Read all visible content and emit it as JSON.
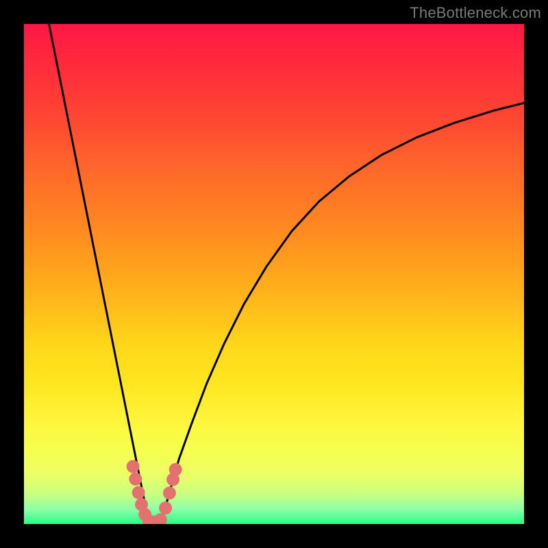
{
  "watermark": "TheBottleneck.com",
  "colors": {
    "frame": "#000000",
    "curve": "#000000",
    "marker": "#e2716f",
    "gradient_top": "#ff1744",
    "gradient_bottom": "#29ff86"
  },
  "chart_data": {
    "type": "line",
    "title": "",
    "xlabel": "",
    "ylabel": "",
    "xlim": [
      0,
      100
    ],
    "ylim": [
      0,
      100
    ],
    "series": [
      {
        "name": "left-branch",
        "x": [
          5.0,
          6.0,
          7.0,
          8.0,
          9.0,
          10.0,
          11.0,
          12.0,
          13.0,
          14.0,
          15.0,
          16.0,
          17.0,
          18.0,
          19.0,
          20.0,
          21.0,
          22.0,
          23.0,
          24.0,
          24.8
        ],
        "values": [
          100.0,
          95.0,
          90.0,
          85.0,
          80.0,
          75.0,
          70.0,
          65.0,
          60.0,
          55.0,
          50.0,
          45.0,
          40.0,
          35.0,
          30.0,
          25.0,
          20.0,
          15.0,
          10.0,
          5.0,
          0.3
        ]
      },
      {
        "name": "bottom-segment",
        "x": [
          24.8,
          25.2,
          25.7,
          26.2,
          26.8,
          27.5
        ],
        "values": [
          0.3,
          0.2,
          0.2,
          0.2,
          0.25,
          0.4
        ]
      },
      {
        "name": "right-branch",
        "x": [
          27.5,
          29.0,
          31.0,
          33.5,
          36.5,
          40.0,
          44.0,
          48.5,
          53.5,
          59.0,
          65.0,
          71.5,
          78.5,
          86.0,
          94.0,
          100.0
        ],
        "values": [
          0.4,
          6.0,
          13.0,
          20.0,
          28.0,
          36.0,
          44.0,
          51.5,
          58.5,
          64.5,
          69.5,
          73.8,
          77.3,
          80.2,
          82.7,
          84.2
        ]
      }
    ],
    "markers": [
      {
        "x": 21.8,
        "y": 11.5,
        "r": 1.3
      },
      {
        "x": 22.3,
        "y": 9.0,
        "r": 1.3
      },
      {
        "x": 22.9,
        "y": 6.3,
        "r": 1.3
      },
      {
        "x": 23.5,
        "y": 3.9,
        "r": 1.3
      },
      {
        "x": 24.2,
        "y": 1.9,
        "r": 1.3
      },
      {
        "x": 25.0,
        "y": 0.55,
        "r": 1.3
      },
      {
        "x": 26.1,
        "y": 0.4,
        "r": 1.3
      },
      {
        "x": 27.3,
        "y": 0.85,
        "r": 1.3
      },
      {
        "x": 28.3,
        "y": 3.2,
        "r": 1.3
      },
      {
        "x": 29.1,
        "y": 6.2,
        "r": 1.3
      },
      {
        "x": 29.8,
        "y": 8.9,
        "r": 1.3
      },
      {
        "x": 30.3,
        "y": 10.9,
        "r": 1.3
      }
    ]
  }
}
